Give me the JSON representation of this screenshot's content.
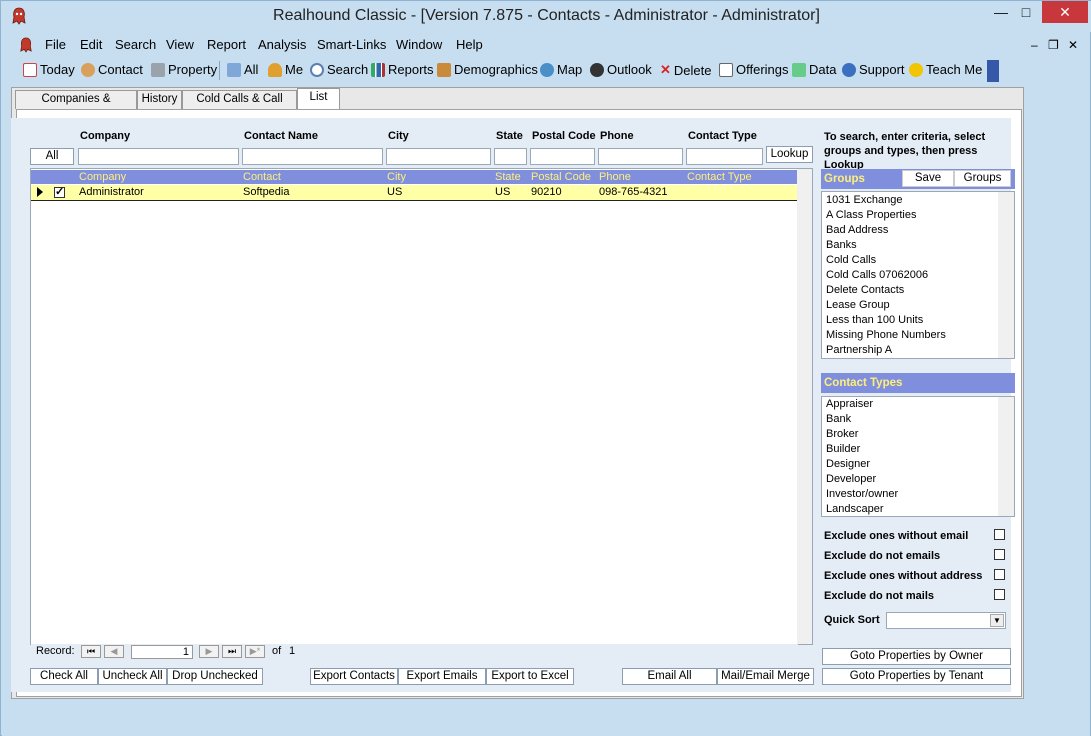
{
  "window": {
    "title": "Realhound Classic - [Version 7.875 - Contacts - Administrator - Administrator]",
    "minimize": "—",
    "maximize": "□",
    "close": "✕"
  },
  "menu": {
    "items": [
      "File",
      "Edit",
      "Search",
      "View",
      "Report",
      "Analysis",
      "Smart-Links",
      "Window",
      "Help"
    ],
    "mdi_min": "–",
    "mdi_restore": "❐",
    "mdi_close": "✕"
  },
  "toolbar": {
    "items": [
      "Today",
      "Contact",
      "Property",
      "All",
      "Me",
      "Search",
      "Reports",
      "Demographics",
      "Map",
      "Outlook",
      "Delete",
      "Offerings",
      "Data",
      "Support",
      "Teach Me"
    ]
  },
  "tabs": [
    "Companies & Contacts",
    "History",
    "Cold Calls & Call Lists",
    "List"
  ],
  "filters": {
    "headers": [
      "Company",
      "Contact Name",
      "City",
      "State",
      "Postal Code",
      "Phone",
      "Contact Type"
    ],
    "all_button": "All",
    "lookup_button": "Lookup"
  },
  "grid": {
    "columns": [
      "Company",
      "Contact",
      "City",
      "State",
      "Postal Code",
      "Phone",
      "Contact Type"
    ],
    "rows": [
      {
        "checked": true,
        "company": "Administrator",
        "contact": "Softpedia",
        "city": "US",
        "state": "US",
        "postal": "90210",
        "phone": "098-765-4321",
        "type": ""
      }
    ]
  },
  "record_nav": {
    "label": "Record:",
    "current": "1",
    "of_label": "of",
    "total": "1"
  },
  "bottom_buttons": {
    "check_all": "Check All",
    "uncheck_all": "Uncheck All",
    "drop_unchecked": "Drop Unchecked",
    "export_contacts": "Export Contacts",
    "export_emails": "Export Emails",
    "export_excel": "Export to Excel",
    "email_all": "Email All",
    "mail_merge": "Mail/Email Merge"
  },
  "right_panel": {
    "hint": "To search, enter criteria, select groups and types, then press Lookup",
    "groups_title": "Groups",
    "groups_save": "Save",
    "groups_button": "Groups",
    "groups": [
      "1031 Exchange",
      "A Class Properties",
      "Bad Address",
      "Banks",
      "Cold Calls",
      "Cold Calls 07062006",
      "Delete Contacts",
      "Lease Group",
      "Less than 100 Units",
      "Missing Phone Numbers",
      "Partnership A"
    ],
    "types_title": "Contact Types",
    "types": [
      "Appraiser",
      "Bank",
      "Broker",
      "Builder",
      "Designer",
      "Developer",
      "Investor/owner",
      "Landscaper"
    ],
    "exclude_no_email": "Exclude ones without email",
    "exclude_do_not_emails": "Exclude do not emails",
    "exclude_no_address": "Exclude ones without address",
    "exclude_do_not_mails": "Exclude do not mails",
    "quick_sort": "Quick Sort",
    "goto_owner": "Goto Properties by Owner",
    "goto_tenant": "Goto Properties by Tenant"
  }
}
